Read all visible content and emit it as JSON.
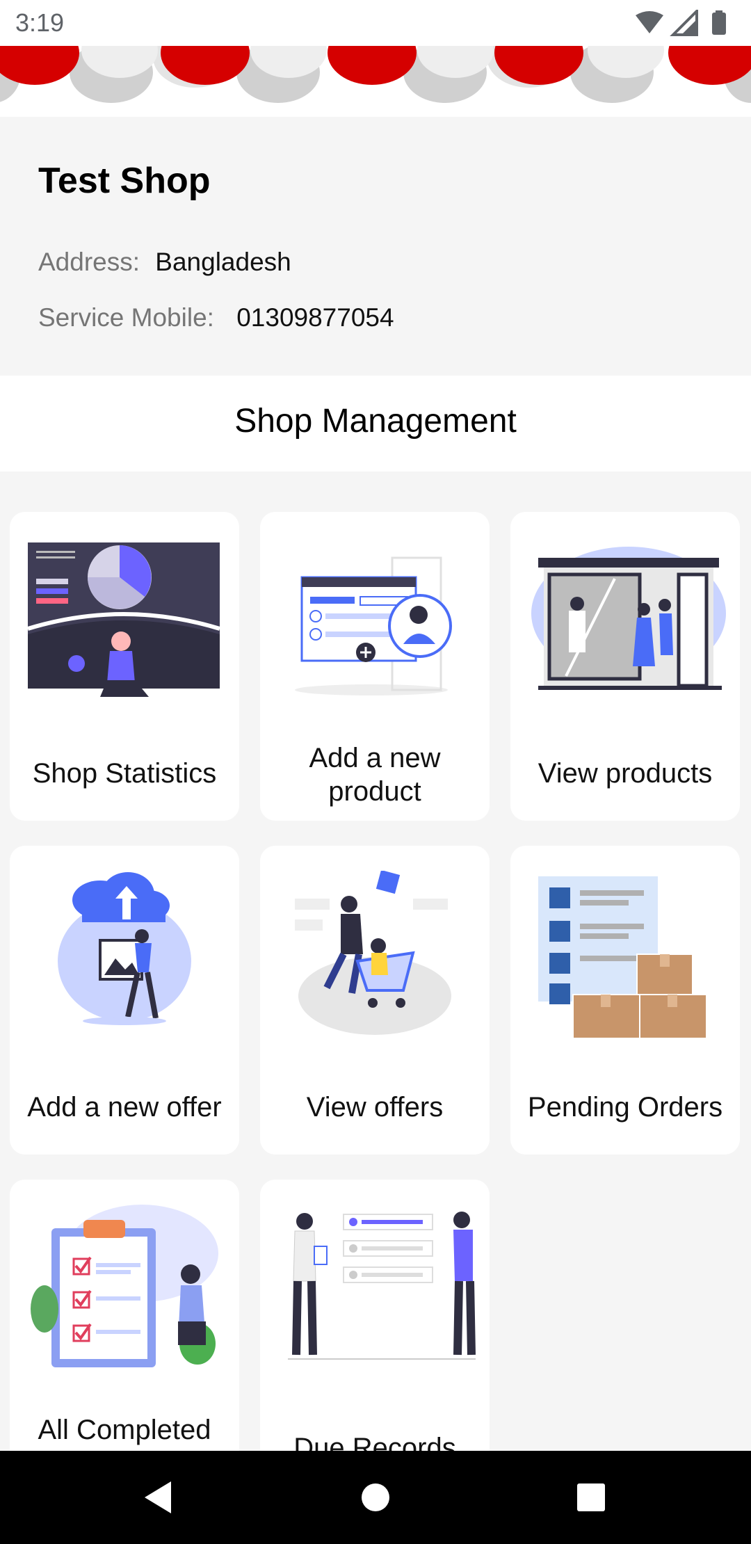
{
  "status_bar": {
    "time": "3:19"
  },
  "shop": {
    "name": "Test Shop",
    "address_label": "Address:",
    "address_value": "Bangladesh",
    "mobile_label": "Service Mobile:",
    "mobile_value": "01309877054"
  },
  "management": {
    "title": "Shop Management",
    "cards": [
      {
        "label": "Shop Statistics",
        "icon": "statistics-illustration"
      },
      {
        "label": "Add a new product",
        "icon": "add-product-illustration"
      },
      {
        "label": "View products",
        "icon": "view-products-illustration"
      },
      {
        "label": "Add a new offer",
        "icon": "add-offer-illustration"
      },
      {
        "label": "View offers",
        "icon": "view-offers-illustration"
      },
      {
        "label": "Pending Orders",
        "icon": "pending-orders-illustration"
      },
      {
        "label": "All Completed Orders",
        "icon": "completed-orders-illustration"
      },
      {
        "label": "Due Records",
        "icon": "due-records-illustration"
      }
    ]
  },
  "colors": {
    "accent": "#6c63ff",
    "blue": "#4a6cf7",
    "awning_red": "#d50000",
    "card_bg": "#ffffff"
  }
}
